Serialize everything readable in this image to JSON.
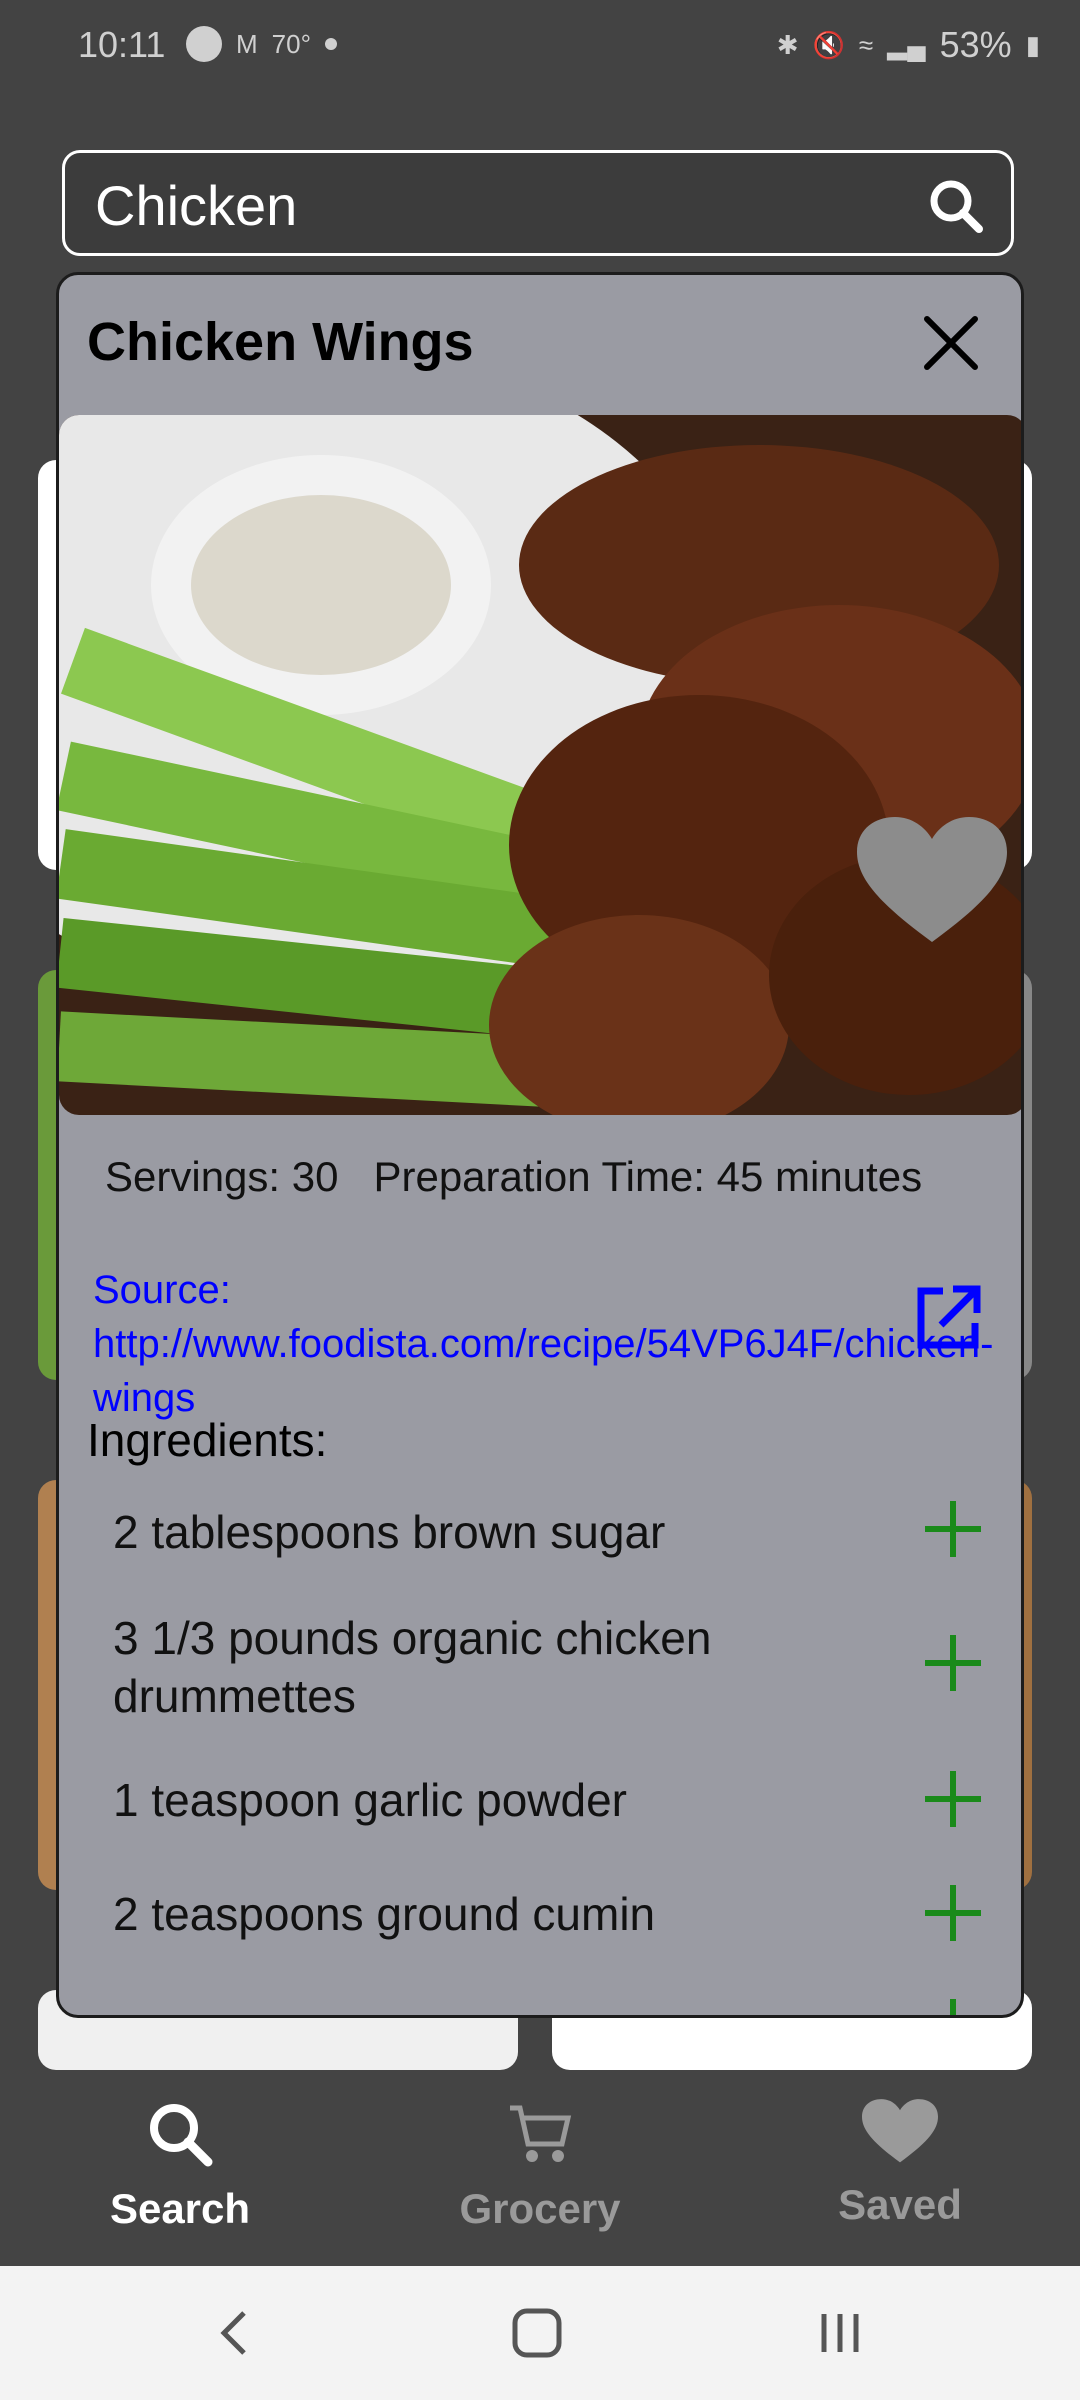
{
  "status_bar": {
    "time": "10:11",
    "temp": "70°",
    "battery": "53%"
  },
  "search": {
    "value": "Chicken",
    "placeholder": ""
  },
  "modal": {
    "title": "Chicken Wings",
    "info": "Servings: 30   Preparation Time: 45 minutes",
    "source": "Source: http://www.foodista.com/recipe/54VP6J4F/chicken-wings",
    "ingredients_title": "Ingredients:",
    "ingredients": [
      "2 tablespoons brown sugar",
      "3 1/3 pounds organic chicken drummettes",
      "1 teaspoon garlic powder",
      "2 teaspoons ground cumin"
    ]
  },
  "nav": {
    "search": "Search",
    "grocery": "Grocery",
    "saved": "Saved"
  },
  "colors": {
    "accent_green": "#1a8a1a",
    "link_blue": "#0000ff",
    "modal_bg": "#9a9ba3"
  }
}
